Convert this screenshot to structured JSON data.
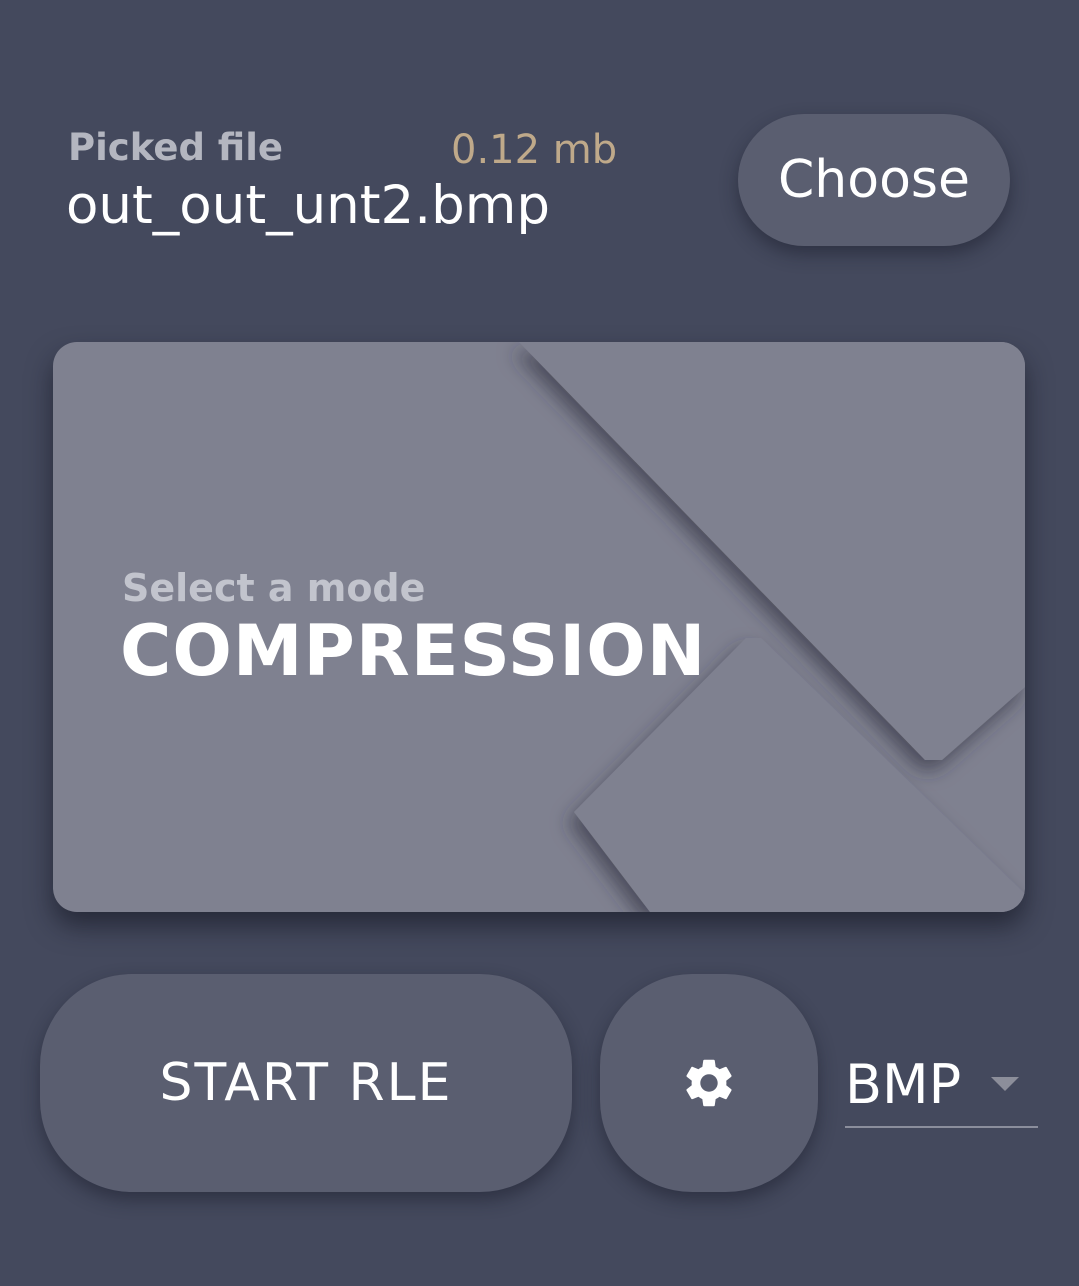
{
  "file": {
    "label": "Picked file",
    "size": "0.12 mb",
    "name": "out_out_unt2.bmp",
    "choose_label": "Choose"
  },
  "mode": {
    "subtitle": "Select a mode",
    "title": "COMPRESSION"
  },
  "actions": {
    "start_label": "START RLE",
    "settings_icon": "gear-icon",
    "format_value": "BMP",
    "format_dropdown_icon": "dropdown-arrow-icon"
  },
  "colors": {
    "background": "#44495d",
    "button": "#5a5e70",
    "card": "#7f8190",
    "file_size": "#bfa98a",
    "text": "#ffffff"
  }
}
